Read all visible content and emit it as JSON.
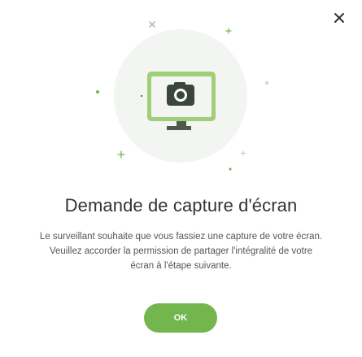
{
  "dialog": {
    "title": "Demande de capture d'écran",
    "message_lines": [
      "Le surveillant souhaite que vous fassiez une capture de votre écran.",
      "Veuillez accorder la permission de partager l'intégralité de votre",
      "écran à l'étape suivante."
    ],
    "ok_label": "OK",
    "close_icon": "close-icon"
  },
  "illustration": {
    "icon": "camera-icon",
    "colors": {
      "accent_green": "#74b64e",
      "circle_bg": "#f3f5f2",
      "screen_bezel": "#9fcf79",
      "stand": "#4e5a4a",
      "camera_body": "#3a463a"
    }
  },
  "colors": {
    "title_text": "#333333",
    "body_text": "#555555",
    "button_bg": "#74b64e",
    "button_text": "#ffffff"
  }
}
